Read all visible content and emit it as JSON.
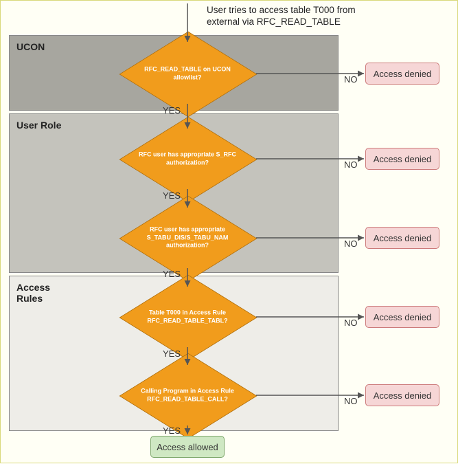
{
  "header": "User tries to access table T000 from external via RFC_READ_TABLE",
  "sections": {
    "ucon": "UCON",
    "userRole": "User Role",
    "accessRules": "Access Rules"
  },
  "decisions": {
    "d1": "RFC_READ_TABLE on UCON allowlist?",
    "d2": "RFC user has appropriate S_RFC authorization?",
    "d3": "RFC user has appropriate S_TABU_DIS/S_TABU_NAM authorization?",
    "d4": "Table T000 in Access Rule RFC_READ_TABLE_TABL?",
    "d5": "Calling Program in Access Rule RFC_READ_TABLE_CALL?"
  },
  "labels": {
    "yes": "YES",
    "no": "NO"
  },
  "outcomes": {
    "denied": "Access denied",
    "allowed": "Access allowed"
  }
}
